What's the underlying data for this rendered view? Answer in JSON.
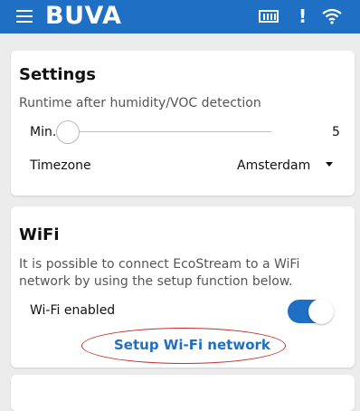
{
  "header": {
    "brand": "BUVA",
    "background": "#1f6fc4",
    "icons": [
      "menu-icon",
      "device-icon",
      "alert-icon",
      "wifi-icon"
    ],
    "alert_symbol": "!"
  },
  "settings": {
    "title": "Settings",
    "runtime_label": "Runtime after humidity/VOC detection",
    "min_label": "Min.",
    "slider_value": "5",
    "timezone_label": "Timezone",
    "timezone_value": "Amsterdam"
  },
  "wifi": {
    "title": "WiFi",
    "description_line1": "It is possible to connect EcoStream to a WiFi",
    "description_line2": "network by using the setup function below.",
    "enabled_label": "Wi-Fi enabled",
    "enabled": true,
    "setup_link": "Setup Wi-Fi network"
  },
  "colors": {
    "accent": "#1f6fc4",
    "highlight": "#c0302b",
    "background": "#ececec"
  }
}
